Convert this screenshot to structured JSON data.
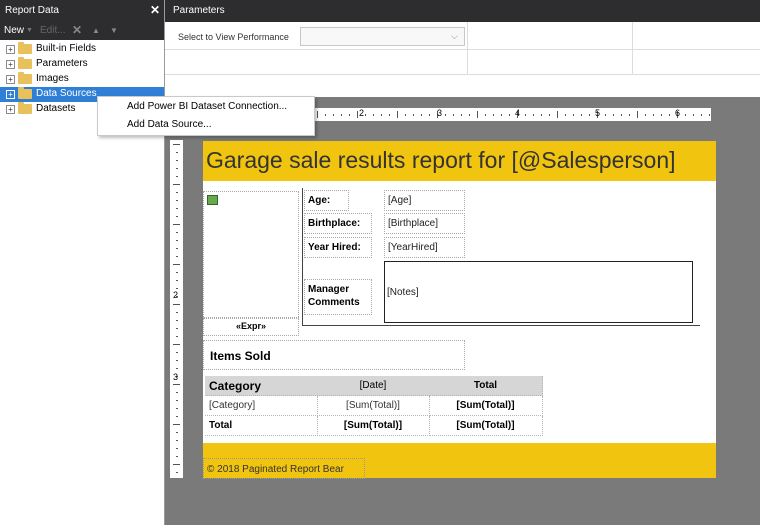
{
  "report_data_pane": {
    "title": "Report Data",
    "close_glyph": "✕",
    "toolbar": {
      "new_label": "New",
      "edit_label": "Edit...",
      "delete_glyph": "✕",
      "up_glyph": "▲",
      "down_glyph": "▼"
    },
    "tree": [
      {
        "label": "Built-in Fields",
        "expander": "+"
      },
      {
        "label": "Parameters",
        "expander": "+"
      },
      {
        "label": "Images",
        "expander": "+"
      },
      {
        "label": "Data Sources",
        "expander": "+",
        "selected": true
      },
      {
        "label": "Datasets",
        "expander": "+"
      }
    ]
  },
  "context_menu": [
    {
      "label": "Add Power BI Dataset Connection..."
    },
    {
      "label": "Add Data Source..."
    }
  ],
  "parameters_pane": {
    "title": "Parameters",
    "label": "Select to View Performance",
    "select_value": "",
    "chevron": "⌵"
  },
  "ruler": {
    "h_labels": [
      "2",
      "3",
      "4",
      "5",
      "6"
    ],
    "v_labels": [
      "2",
      "3"
    ]
  },
  "report": {
    "title": "Garage sale results report for [@Salesperson]",
    "image_placeholder": "",
    "expr_label": "«Expr»",
    "fields": [
      {
        "label": "Age:",
        "value": "[Age]"
      },
      {
        "label": "Birthplace:",
        "value": "[Birthplace]"
      },
      {
        "label": "Year Hired:",
        "value": "[YearHired]"
      }
    ],
    "manager_label_1": "Manager",
    "manager_label_2": "Comments",
    "notes_value": "[Notes]",
    "items_title": "Items Sold",
    "table": {
      "headers": [
        "Category",
        "[Date]",
        "Total"
      ],
      "detail": [
        "[Category]",
        "[Sum(Total)]",
        "[Sum(Total)]"
      ],
      "total": [
        "Total",
        "[Sum(Total)]",
        "[Sum(Total)]"
      ]
    },
    "footer": "© 2018 Paginated Report Bear"
  },
  "colors": {
    "band_yellow": "#f1c40f",
    "selection_blue": "#2f7fd7",
    "titlebar_dark": "#2d2d30"
  }
}
